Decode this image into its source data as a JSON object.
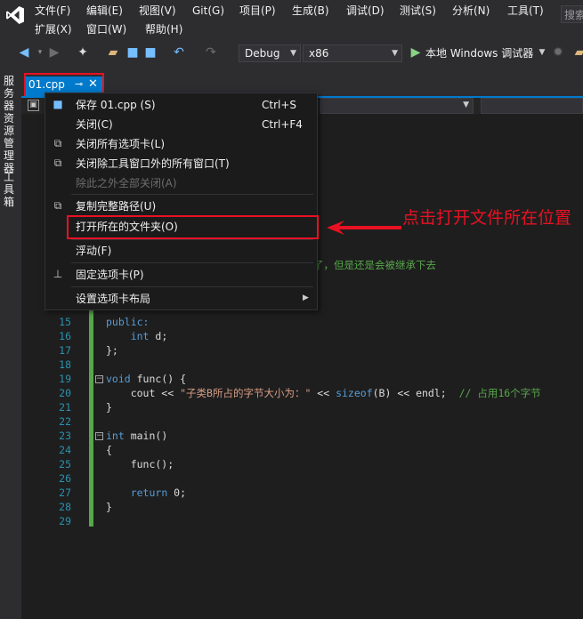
{
  "menubar": {
    "row1": [
      "文件(F)",
      "编辑(E)",
      "视图(V)",
      "Git(G)",
      "项目(P)",
      "生成(B)",
      "调试(D)",
      "测试(S)",
      "分析(N)",
      "工具(T)"
    ],
    "row2": [
      "扩展(X)",
      "窗口(W)",
      "帮助(H)"
    ],
    "search_placeholder": "搜索"
  },
  "toolbar": {
    "config": "Debug",
    "platform": "x86",
    "run_label": "本地 Windows 调试器"
  },
  "sidebar": {
    "item1": "服务器资源管理器",
    "item2": "工具箱"
  },
  "tab": {
    "label": "01.cpp",
    "pin": "⊸",
    "close": "✕"
  },
  "context_menu": {
    "save": "保存 01.cpp (S)",
    "save_shortcut": "Ctrl+S",
    "close": "关闭(C)",
    "close_shortcut": "Ctrl+F4",
    "close_all": "关闭所有选项卡(L)",
    "close_all_but_tool": "关闭除工具窗口外的所有窗口(T)",
    "close_all_but_this": "除此之外全部关闭(A)",
    "copy_path": "复制完整路径(U)",
    "open_folder": "打开所在的文件夹(O)",
    "float": "浮动(F)",
    "pin_tab": "固定选项卡(P)",
    "tab_layout": "设置选项卡布局"
  },
  "annotation": {
    "text": "点击打开文件所在位置"
  },
  "code": {
    "partial_comment": "了，但是还是会被继承下去",
    "lines": [
      {
        "n": "15",
        "text": "public:"
      },
      {
        "n": "16",
        "text": "    int d;"
      },
      {
        "n": "17",
        "text": "};"
      },
      {
        "n": "18",
        "text": ""
      },
      {
        "n": "19",
        "text": "void func() {"
      },
      {
        "n": "20",
        "text": "    cout << \"子类B所占的字节大小为：\" << sizeof(B) << endl;  // 占用16个字节"
      },
      {
        "n": "21",
        "text": "}"
      },
      {
        "n": "22",
        "text": ""
      },
      {
        "n": "23",
        "text": "int main()"
      },
      {
        "n": "24",
        "text": "{"
      },
      {
        "n": "25",
        "text": "    func();"
      },
      {
        "n": "26",
        "text": ""
      },
      {
        "n": "27",
        "text": "    return 0;"
      },
      {
        "n": "28",
        "text": "}"
      },
      {
        "n": "29",
        "text": ""
      }
    ]
  },
  "colors": {
    "accent": "#007acc",
    "highlight": "#e81123",
    "keyword": "#569cd6",
    "string": "#d69d85",
    "comment": "#57a64a"
  }
}
